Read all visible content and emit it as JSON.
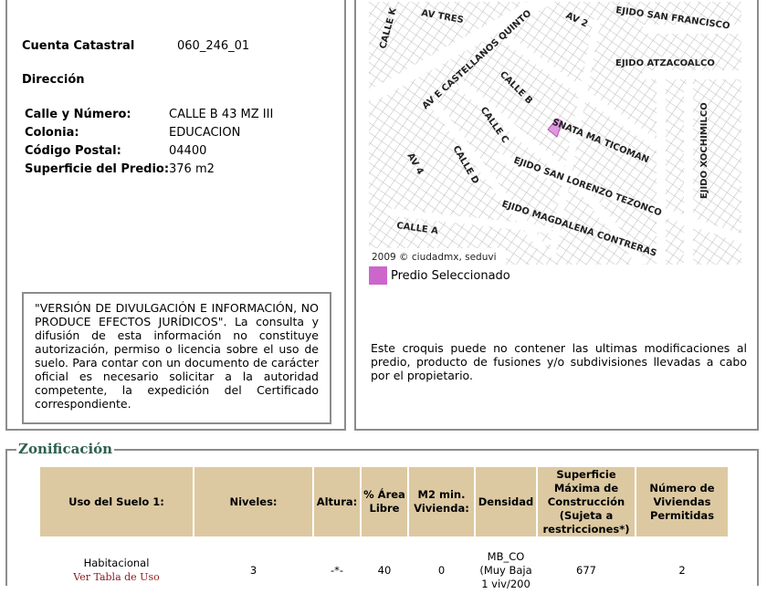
{
  "predio": {
    "cuenta_label": "Cuenta Catastral",
    "cuenta_value": "060_246_01",
    "direccion_label": "Dirección",
    "fields": [
      {
        "label": "Calle y Número:",
        "value": "CALLE B 43 MZ III"
      },
      {
        "label": "Colonia:",
        "value": "EDUCACION"
      },
      {
        "label": "Código Postal:",
        "value": "04400"
      },
      {
        "label": "Superficie del Predio:",
        "value": "376 m2"
      }
    ],
    "disclaimer": "\"VERSIÓN DE DIVULGACIÓN E INFORMACIÓN, NO PRODUCE EFECTOS JURÍDICOS\". La consulta y difusión de esta información no constituye autorización, permiso o licencia sobre el uso de suelo. Para contar con un documento de carácter oficial es necesario solicitar a la autoridad competente, la expedición del Certificado correspondiente."
  },
  "map": {
    "streets": [
      "AV TRES",
      "CALLE K",
      "AV 2",
      "EJIDO SAN FRANCISCO",
      "EJIDO ATZACOALCO",
      "AV E CASTELLANOS QUINTO",
      "CALLE B",
      "SNATA MA TICOMAN",
      "EJIDO XOCHIMILCO",
      "CALLE C",
      "CALLE D",
      "AV 4",
      "EJIDO SAN LORENZO TEZONCO",
      "EJIDO MAGDALENA CONTRERAS",
      "CALLE A"
    ],
    "copyright": "2009 © ciudadmx, seduvi",
    "legend": "Predio Seleccionado",
    "selected_color": "#cc66cc",
    "note": "Este croquis puede no contener las ultimas modificaciones al predio, producto de fusiones y/o subdivisiones llevadas a cabo por el propietario."
  },
  "zonificacion": {
    "title": "Zonificación",
    "headers": [
      "Uso del Suelo 1:",
      "Niveles:",
      "Altura:",
      "% Área Libre",
      "M2 min. Vivienda:",
      "Densidad",
      "Superficie Máxima de Construcción (Sujeta a restricciones*)",
      "Número de Viviendas Permitidas"
    ],
    "row": {
      "uso": "Habitacional",
      "link": "Ver Tabla de Uso",
      "niveles": "3",
      "altura": "-*-",
      "area_libre": "40",
      "m2_min": "0",
      "densidad": "MB_CO (Muy Baja 1 viv/200",
      "superficie": "677",
      "viviendas": "2"
    }
  }
}
